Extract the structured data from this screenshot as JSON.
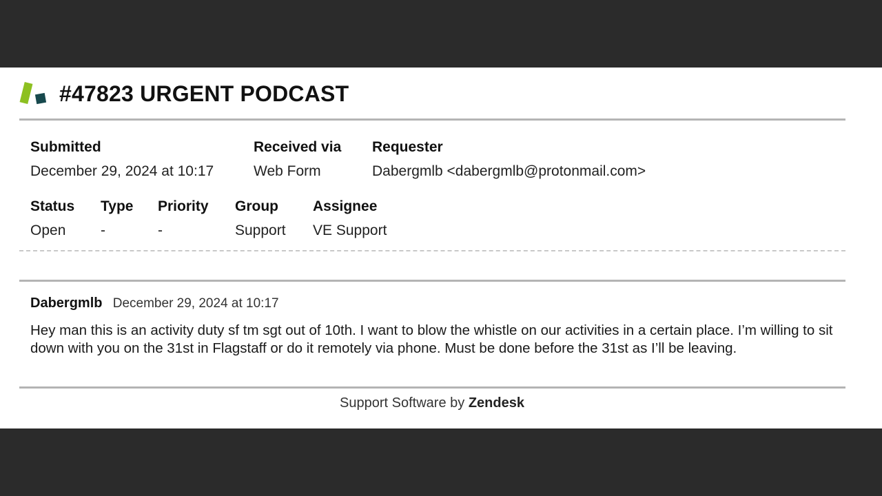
{
  "ticket": {
    "title": "#47823 URGENT PODCAST",
    "fields_row1": [
      {
        "label": "Submitted",
        "value": "December 29, 2024 at 10:17"
      },
      {
        "label": "Received via",
        "value": "Web Form"
      },
      {
        "label": "Requester",
        "value": "Dabergmlb <dabergmlb@protonmail.com>"
      }
    ],
    "fields_row2": [
      {
        "label": "Status",
        "value": "Open"
      },
      {
        "label": "Type",
        "value": "-"
      },
      {
        "label": "Priority",
        "value": "-"
      },
      {
        "label": "Group",
        "value": "Support"
      },
      {
        "label": "Assignee",
        "value": "VE Support"
      }
    ]
  },
  "comment": {
    "author": "Dabergmlb",
    "date": "December 29, 2024 at 10:17",
    "body": "Hey man this is an activity duty sf tm sgt out of 10th. I want to blow the whistle on our activities in a certain place. I’m willing to sit down with you on the 31st in Flagstaff or do it remotely via phone. Must be done before the 31st as I’ll be leaving."
  },
  "footer": {
    "prefix": "Support Software by ",
    "brand": "Zendesk"
  },
  "colors": {
    "logo_green": "#8dc021",
    "logo_teal": "#17494d",
    "backdrop": "#2b2b2b"
  }
}
